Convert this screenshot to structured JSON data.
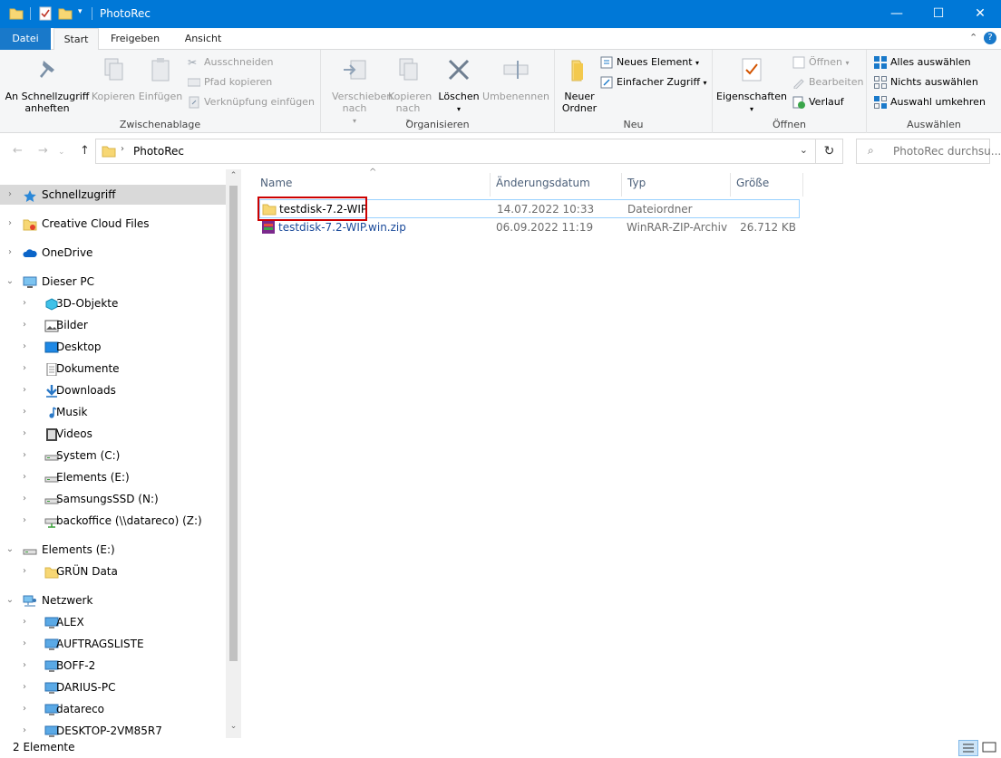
{
  "window": {
    "title": "PhotoRec"
  },
  "ribbon_tabs": [
    "Datei",
    "Start",
    "Freigeben",
    "Ansicht"
  ],
  "ribbon": {
    "clipboard": {
      "label": "Zwischenablage",
      "pin": "An Schnellzugriff anheften",
      "copy": "Kopieren",
      "paste": "Einfügen",
      "cut": "Ausschneiden",
      "copy_path": "Pfad kopieren",
      "paste_shortcut": "Verknüpfung einfügen"
    },
    "organize": {
      "label": "Organisieren",
      "move": "Verschieben nach",
      "copy_to": "Kopieren nach",
      "delete": "Löschen",
      "rename": "Umbenennen"
    },
    "new": {
      "label": "Neu",
      "new_folder": "Neuer Ordner",
      "new_item": "Neues Element",
      "easy_access": "Einfacher Zugriff"
    },
    "open": {
      "label": "Öffnen",
      "properties": "Eigenschaften",
      "open": "Öffnen",
      "edit": "Bearbeiten",
      "history": "Verlauf"
    },
    "select": {
      "label": "Auswählen",
      "select_all": "Alles auswählen",
      "select_none": "Nichts auswählen",
      "invert": "Auswahl umkehren"
    }
  },
  "address": {
    "path": "PhotoRec",
    "search_placeholder": "PhotoRec durchsu..."
  },
  "nav": [
    {
      "label": "Schnellzugriff",
      "level": 0,
      "icon": "star-icon",
      "selected": true
    },
    {
      "label": "Creative Cloud Files",
      "level": 0,
      "icon": "creative-cloud-icon"
    },
    {
      "label": "OneDrive",
      "level": 0,
      "icon": "cloud-icon"
    },
    {
      "label": "Dieser PC",
      "level": 0,
      "icon": "computer-icon",
      "expanded": true
    },
    {
      "label": "3D-Objekte",
      "level": 1,
      "icon": "cube-icon"
    },
    {
      "label": "Bilder",
      "level": 1,
      "icon": "pictures-icon"
    },
    {
      "label": "Desktop",
      "level": 1,
      "icon": "desktop-icon"
    },
    {
      "label": "Dokumente",
      "level": 1,
      "icon": "document-icon"
    },
    {
      "label": "Downloads",
      "level": 1,
      "icon": "download-icon"
    },
    {
      "label": "Musik",
      "level": 1,
      "icon": "music-icon"
    },
    {
      "label": "Videos",
      "level": 1,
      "icon": "video-icon"
    },
    {
      "label": "System (C:)",
      "level": 1,
      "icon": "drive-icon"
    },
    {
      "label": "Elements (E:)",
      "level": 1,
      "icon": "drive-icon"
    },
    {
      "label": "SamsungsSSD (N:)",
      "level": 1,
      "icon": "drive-icon"
    },
    {
      "label": "backoffice (\\\\datareco) (Z:)",
      "level": 1,
      "icon": "network-drive-icon"
    },
    {
      "label": "Elements (E:)",
      "level": 0,
      "icon": "drive-icon",
      "expanded": true
    },
    {
      "label": "GRÜN Data",
      "level": 1,
      "icon": "folder-icon"
    },
    {
      "label": "Netzwerk",
      "level": 0,
      "icon": "network-icon",
      "expanded": true
    },
    {
      "label": "ALEX",
      "level": 1,
      "icon": "monitor-icon"
    },
    {
      "label": "AUFTRAGSLISTE",
      "level": 1,
      "icon": "monitor-icon"
    },
    {
      "label": "BOFF-2",
      "level": 1,
      "icon": "monitor-icon"
    },
    {
      "label": "DARIUS-PC",
      "level": 1,
      "icon": "monitor-icon"
    },
    {
      "label": "datareco",
      "level": 1,
      "icon": "monitor-icon"
    },
    {
      "label": "DESKTOP-2VM85R7",
      "level": 1,
      "icon": "monitor-icon"
    }
  ],
  "columns": [
    "Name",
    "Änderungsdatum",
    "Typ",
    "Größe"
  ],
  "files": [
    {
      "name": "testdisk-7.2-WIP",
      "date": "14.07.2022 10:33",
      "type": "Dateiordner",
      "size": "",
      "icon": "folder-icon",
      "selected": true
    },
    {
      "name": "testdisk-7.2-WIP.win.zip",
      "date": "06.09.2022 11:19",
      "type": "WinRAR-ZIP-Archiv",
      "size": "26.712 KB",
      "icon": "winrar-icon"
    }
  ],
  "status": {
    "count": "2 Elemente"
  },
  "colors": {
    "titlebar": "#0078d7",
    "file_tab": "#1979ca",
    "highlight": "#cc0000",
    "zip_name": "#1a4a9a"
  }
}
